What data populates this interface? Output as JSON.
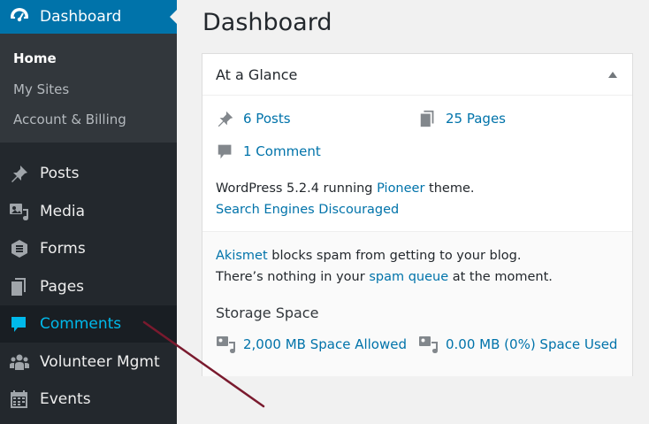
{
  "sidebar": {
    "dashboard": {
      "label": "Dashboard",
      "icon": "dashboard-icon"
    },
    "submenu": [
      {
        "label": "Home",
        "current": true
      },
      {
        "label": "My Sites"
      },
      {
        "label": "Account & Billing"
      }
    ],
    "items": [
      {
        "label": "Posts",
        "icon": "pushpin-icon"
      },
      {
        "label": "Media",
        "icon": "media-icon"
      },
      {
        "label": "Forms",
        "icon": "forms-icon"
      },
      {
        "label": "Pages",
        "icon": "pages-icon"
      },
      {
        "label": "Comments",
        "icon": "comment-icon"
      },
      {
        "label": "Volunteer Mgmt",
        "icon": "groups-icon"
      },
      {
        "label": "Events",
        "icon": "calendar-icon"
      }
    ]
  },
  "main": {
    "title": "Dashboard",
    "panel": {
      "title": "At a Glance",
      "posts": "6 Posts",
      "pages": "25 Pages",
      "comments": "1 Comment",
      "wp_pre": "WordPress 5.2.4 running ",
      "theme": "Pioneer",
      "wp_post": " theme.",
      "search_engines": "Search Engines Discouraged",
      "akismet": "Akismet",
      "akismet_rest": " blocks spam from getting to your blog.",
      "spam_pre": "There’s nothing in your ",
      "spam_queue": "spam queue",
      "spam_post": " at the moment.",
      "storage_title": "Storage Space",
      "space_allowed": "2,000 MB Space Allowed",
      "space_used": "0.00 MB (0%) Space Used"
    }
  },
  "colors": {
    "sidebar_bg": "#23282d",
    "submenu_bg": "#32373c",
    "active_bg": "#0073aa",
    "link": "#0073aa",
    "highlight_text": "#00b9eb",
    "annotation_arrow": "#7a1a2e"
  }
}
